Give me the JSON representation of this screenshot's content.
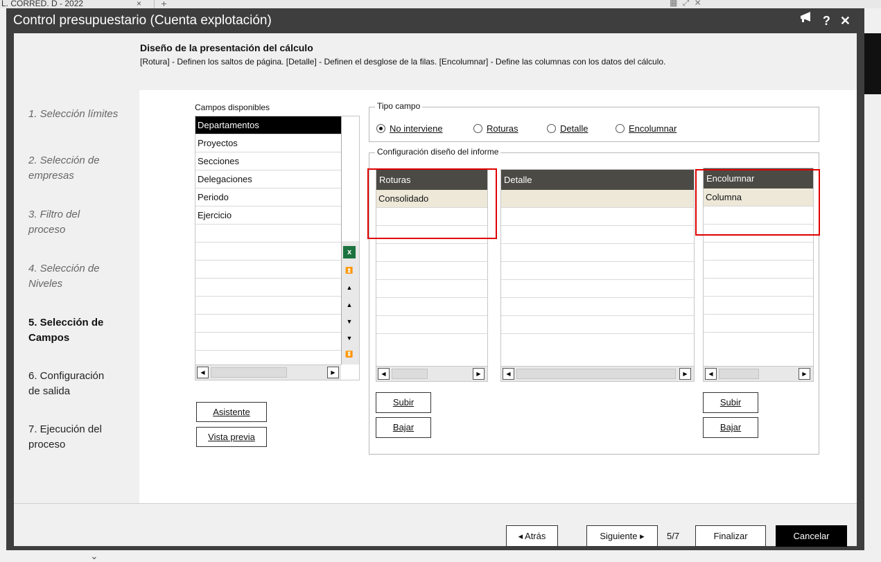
{
  "background": {
    "tab_title": "L. CORRED. D - 2022",
    "close_glyph": "×",
    "plus_glyph": "+",
    "window_controls": "▦ ⤢ ✕",
    "chevron": "⌄"
  },
  "dialog": {
    "title": "Control presupuestario (Cuenta explotación)",
    "megaphone_glyph": "📢",
    "help_glyph": "?",
    "close_glyph": "✕"
  },
  "header": {
    "title": "Diseño de la presentación del cálculo",
    "description": "[Rotura] - Definen los saltos de página.   [Detalle] - Definen el desglose de la filas.   [Encolumnar] - Define las columnas con los datos del cálculo."
  },
  "steps": [
    {
      "label": "1. Selección límites"
    },
    {
      "label": "2. Selección de\nempresas"
    },
    {
      "label": "3. Filtro del\nproceso"
    },
    {
      "label": "4. Selección de\nNiveles"
    },
    {
      "label": "5. Selección de\nCampos"
    },
    {
      "label": "6. Configuración\nde salida"
    },
    {
      "label": "7. Ejecución del\nproceso"
    }
  ],
  "campos": {
    "label": "Campos disponibles",
    "items": [
      "Departamentos",
      "Proyectos",
      "Secciones",
      "Delegaciones",
      "Periodo",
      "Ejercicio"
    ],
    "selected_index": 0,
    "excel_glyph": "x",
    "tools": [
      "⏫",
      "▲",
      "▲",
      "▼",
      "▼",
      "⏬"
    ]
  },
  "tipo_campo": {
    "legend": "Tipo campo",
    "options": [
      "No interviene",
      "Roturas",
      "Detalle",
      "Encolumnar"
    ],
    "selected": "No interviene"
  },
  "config": {
    "legend": "Configuración diseño del informe",
    "roturas": {
      "header": "Roturas",
      "rows": [
        "Consolidado"
      ]
    },
    "detalle": {
      "header": "Detalle",
      "rows": []
    },
    "encolumnar": {
      "header": "Encolumnar",
      "rows": [
        "Columna"
      ]
    }
  },
  "buttons": {
    "asistente": "Asistente",
    "vista_previa": "Vista previa",
    "subir": "Subir",
    "bajar": "Bajar"
  },
  "scroll": {
    "left": "◀",
    "right": "▶"
  },
  "footer": {
    "atras": "◂  Atrás",
    "siguiente": "Siguiente  ▸",
    "page": "5/7",
    "finalizar": "Finalizar",
    "cancelar": "Cancelar"
  },
  "highlight_color": "#e00000"
}
